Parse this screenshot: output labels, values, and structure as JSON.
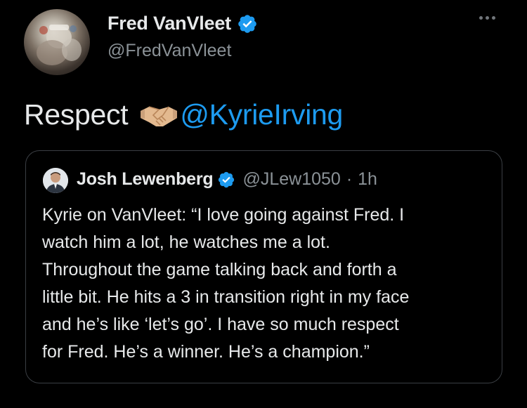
{
  "tweet": {
    "display_name": "Fred VanVleet",
    "handle": "@FredVanVleet",
    "text": "Respect",
    "mention": "@KyrieIrving",
    "emoji": "handshake-emoji"
  },
  "quoted": {
    "display_name": "Josh Lewenberg",
    "handle": "@JLew1050",
    "separator": "·",
    "time": "1h",
    "lines": [
      "Kyrie on VanVleet: “I love going against Fred. I",
      "watch him a lot, he watches me a lot.",
      "Throughout the game talking back and forth a",
      "little bit. He hits a 3 in transition right in my face",
      "and he’s like ‘let’s go’. I have so much respect",
      "for Fred. He’s a winner. He’s a champion.”"
    ]
  },
  "colors": {
    "background": "#000000",
    "text": "#e7e9ea",
    "secondary": "#8b9297",
    "accent": "#1d9bf0",
    "border": "#3b3f44"
  },
  "icons": [
    "verified-badge-icon",
    "more-options-icon",
    "handshake-emoji"
  ]
}
